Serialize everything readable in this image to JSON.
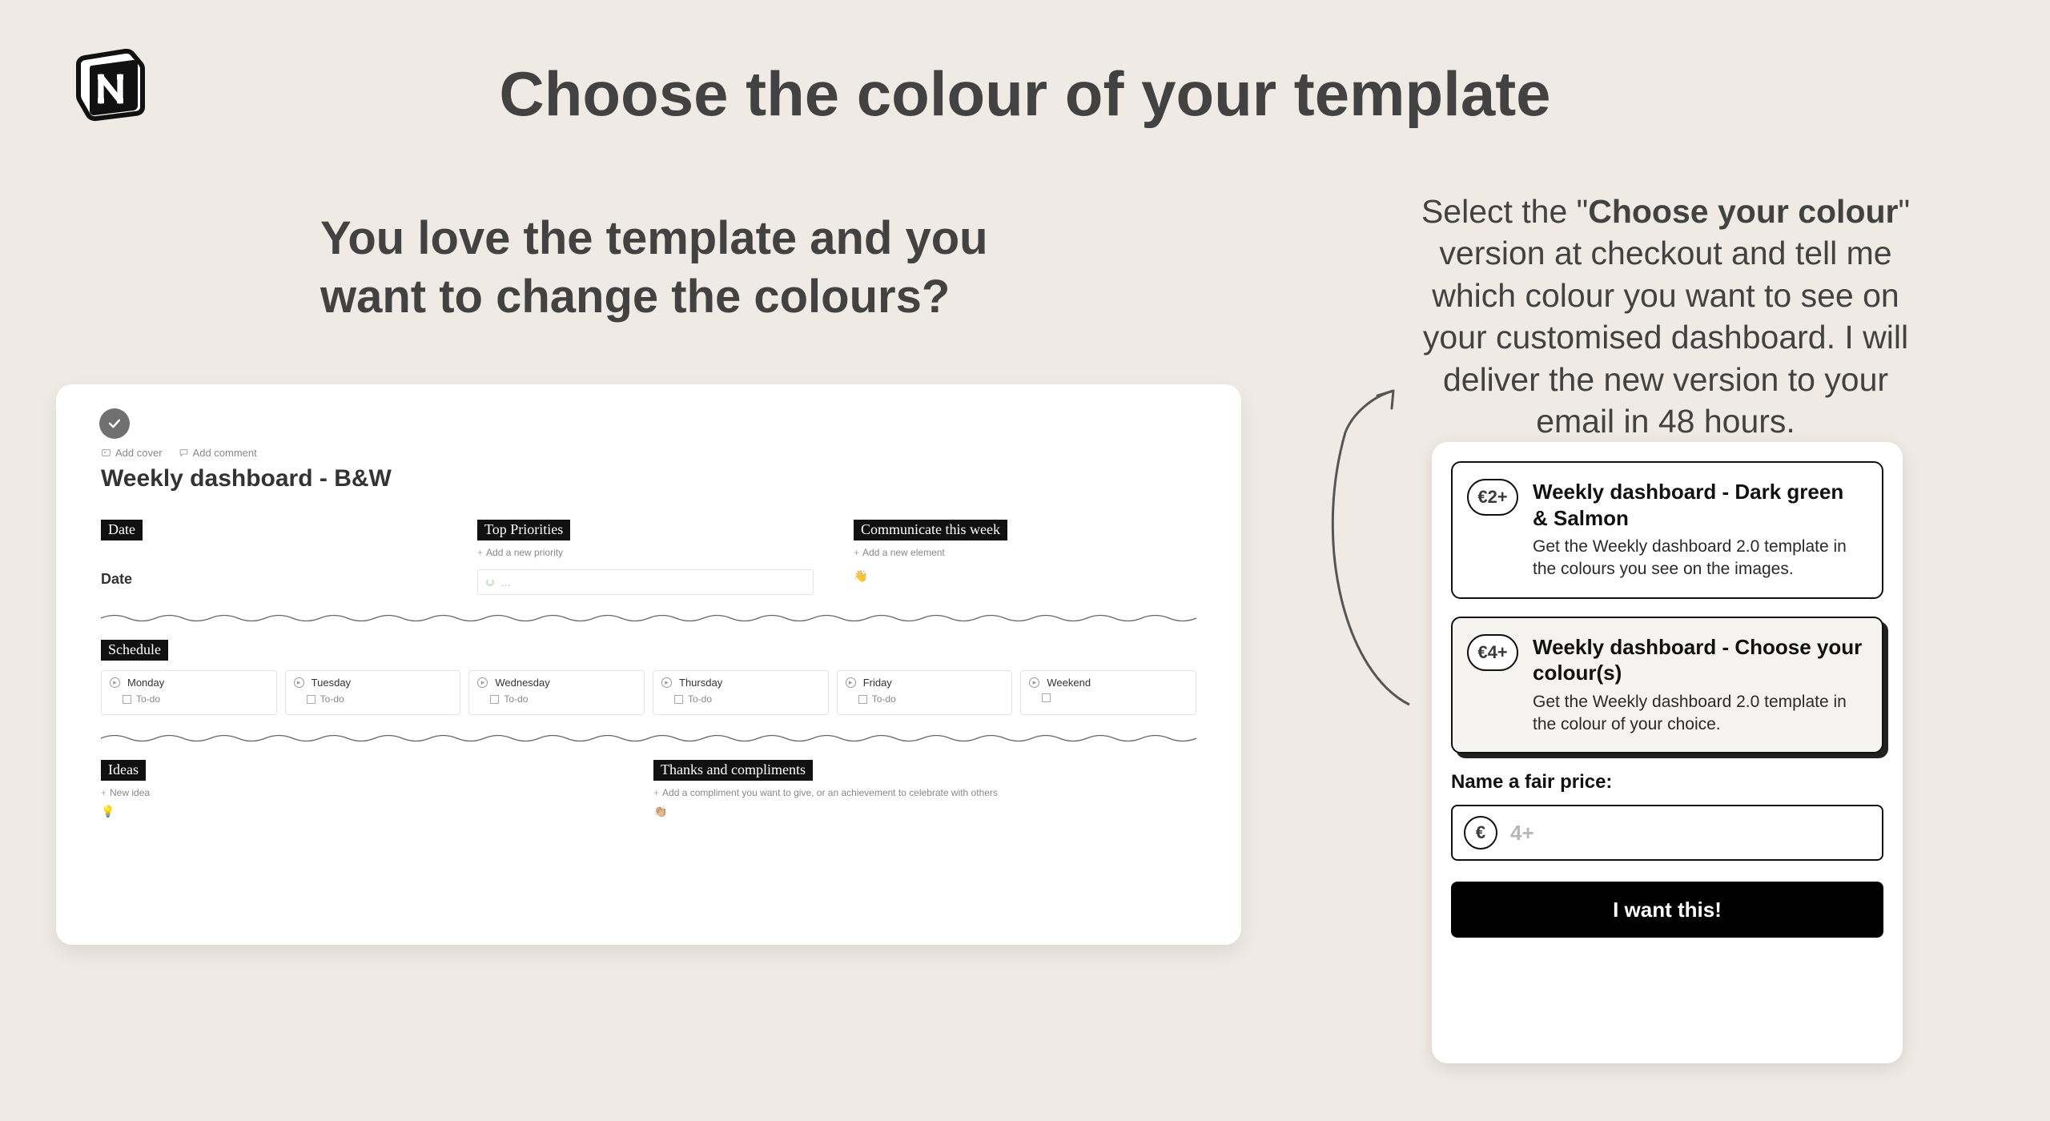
{
  "page_title": "Choose the colour of your template",
  "subheading": "You love the template and you want to change the colours?",
  "body": {
    "pre": "Select the \"",
    "highlight": "Choose your colour",
    "post": "\" version at checkout and tell me which colour you want to see on your customised dashboard. I will deliver the new version to your email in 48 hours."
  },
  "preview": {
    "meta": {
      "add_cover": "Add cover",
      "add_comment": "Add comment"
    },
    "title": "Weekly dashboard - B&W",
    "sections": {
      "date": {
        "tag": "Date",
        "sub": "Date"
      },
      "priorities": {
        "tag": "Top Priorities",
        "add": "Add a new priority",
        "placeholder": "…"
      },
      "communicate": {
        "tag": "Communicate this week",
        "add": "Add a new element",
        "emoji": "👋"
      },
      "schedule": {
        "tag": "Schedule",
        "days": [
          "Monday",
          "Tuesday",
          "Wednesday",
          "Thursday",
          "Friday",
          "Weekend"
        ],
        "todo": "To-do"
      },
      "ideas": {
        "tag": "Ideas",
        "add": "New idea",
        "emoji": "💡"
      },
      "thanks": {
        "tag": "Thanks and compliments",
        "add": "Add a compliment you want to give, or an achievement to celebrate with others",
        "emoji": "👏🏼"
      }
    }
  },
  "checkout": {
    "plans": [
      {
        "price": "€2+",
        "title": "Weekly dashboard - Dark green & Salmon",
        "desc": "Get the Weekly dashboard 2.0 template in the colours you see on the images."
      },
      {
        "price": "€4+",
        "title": "Weekly dashboard - Choose your colour(s)",
        "desc": "Get the Weekly dashboard 2.0 template in the colour of your choice."
      }
    ],
    "fair_label": "Name a fair price:",
    "currency": "€",
    "placeholder": "4+",
    "cta": "I want this!"
  }
}
